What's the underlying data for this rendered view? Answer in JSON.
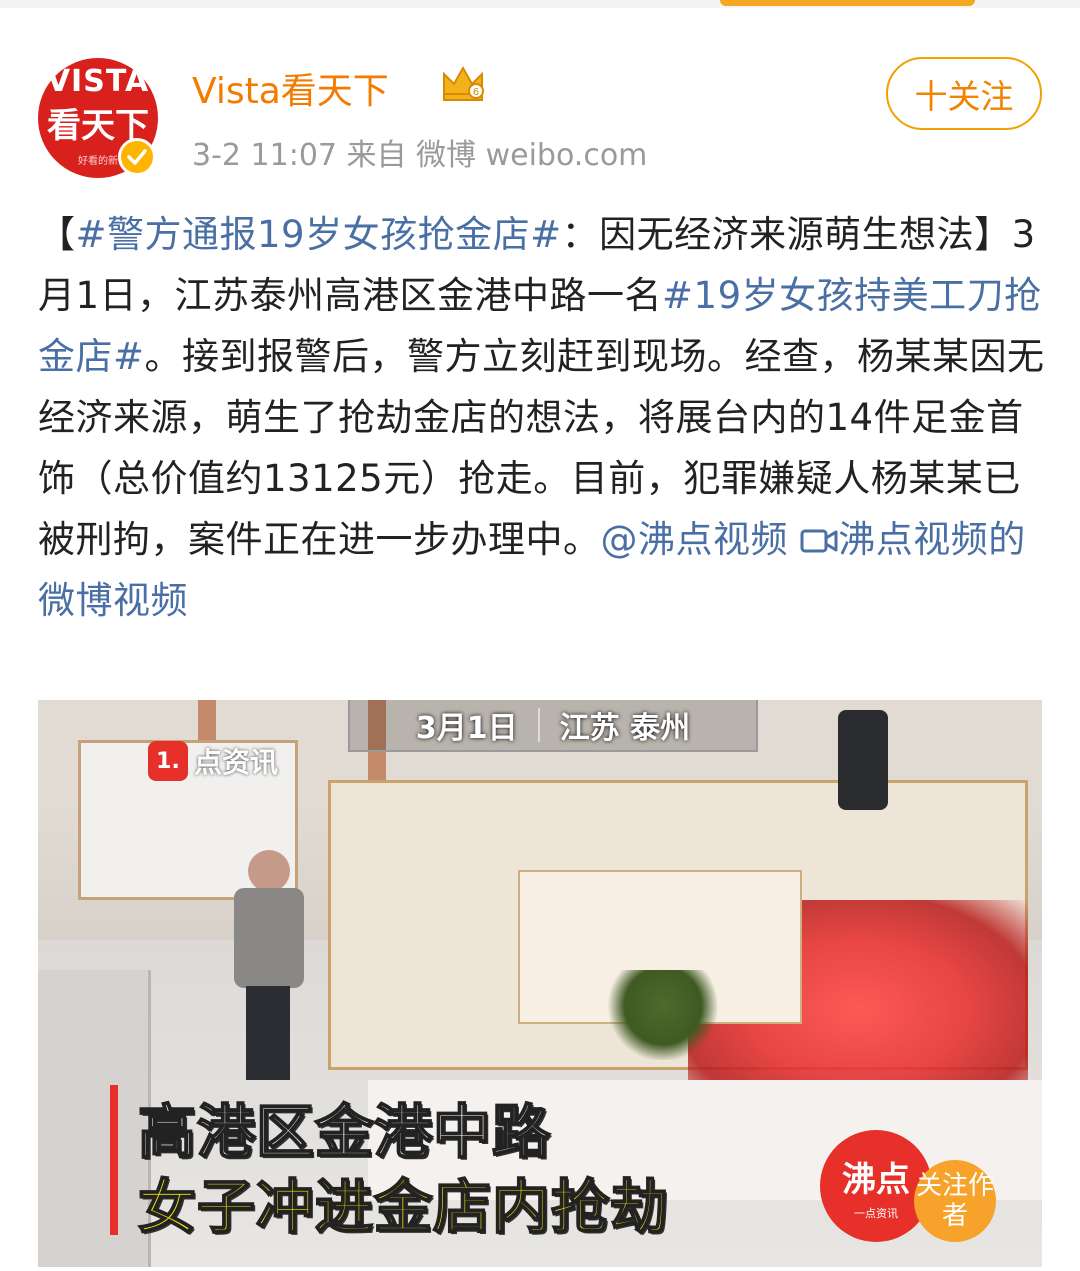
{
  "header": {
    "avatar_text_1": "VISTA",
    "avatar_text_2": "看天下",
    "avatar_text_3": "好看的新",
    "username": "Vista看天下",
    "meta": "3-2 11:07  来自 微博 weibo.com",
    "follow_label": "十关注"
  },
  "post": {
    "bracket_open": "【",
    "hashtag1": "#警方通报19岁女孩抢金店#",
    "title_rest": "：因无经济来源萌生想法】3月1日，江苏泰州高港区金港中路一名",
    "hashtag2": "#19岁女孩持美工刀抢金店#",
    "body": "。接到报警后，警方立刻赶到现场。经查，杨某某因无经济来源，萌生了抢劫金店的想法，将展台内的14件足金首饰（总价值约13125元）抢走。目前，犯罪嫌疑人杨某某已被刑拘，案件正在进一步办理中。",
    "mention": "@沸点视频",
    "video_link": "沸点视频的微博视频"
  },
  "video": {
    "date": "3月1日",
    "location": "江苏 泰州",
    "source_badge": "1.",
    "source_text": "点资讯",
    "caption_line1": "高港区金港中路",
    "caption_line2": "女子冲进金店内抢劫",
    "logo_main": "沸点",
    "logo_sub": "一点资讯",
    "follow_author": "关注作者"
  },
  "colors": {
    "link": "#4a6fa5",
    "username": "#f37b00",
    "follow_border": "#f1a100",
    "meta_gray": "#9a9a9a"
  }
}
